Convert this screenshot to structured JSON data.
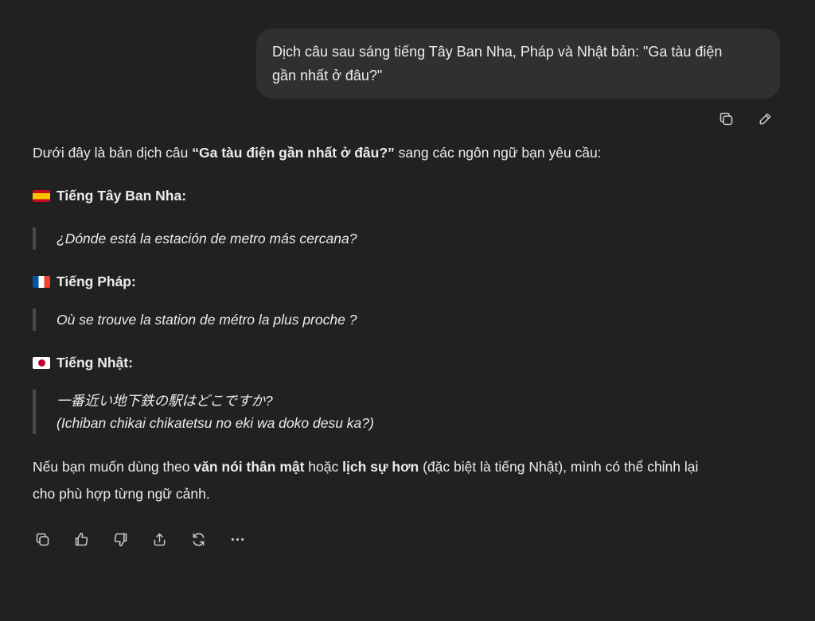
{
  "user_message": {
    "line1": "Dịch câu sau sáng tiếng Tây Ban Nha, Pháp và Nhật bản: \"Ga tàu điện",
    "line2": "gần nhất ở đâu?\""
  },
  "user_actions": {
    "copy_icon": "copy-icon",
    "edit_icon": "pencil-icon"
  },
  "answer": {
    "intro_before": "Dưới đây là bản dịch câu ",
    "intro_bold": "“Ga tàu điện gần nhất ở đâu?”",
    "intro_after": " sang các ngôn ngữ bạn yêu cầu:",
    "sections": [
      {
        "flag": "spain-flag",
        "title": "Tiếng Tây Ban Nha:",
        "lines": [
          "¿Dónde está la estación de metro más cercana?"
        ]
      },
      {
        "flag": "france-flag",
        "title": "Tiếng Pháp:",
        "lines": [
          "Où se trouve la station de métro la plus proche ?"
        ]
      },
      {
        "flag": "japan-flag",
        "title": "Tiếng Nhật:",
        "lines": [
          "一番近い地下鉄の駅はどこですか?",
          "(Ichiban chikai chikatetsu no eki wa doko desu ka?)"
        ]
      }
    ],
    "outro": {
      "part1": "Nếu bạn muốn dùng theo ",
      "bold1": "văn nói thân mật",
      "part2": " hoặc ",
      "bold2": "lịch sự hơn",
      "part3": " (đặc biệt là tiếng Nhật), mình có thể chỉnh lại",
      "line2": "cho phù hợp từng ngữ cảnh."
    }
  },
  "bottom_actions": [
    "copy-icon",
    "thumbs-up-icon",
    "thumbs-down-icon",
    "share-icon",
    "regenerate-icon",
    "more-icon"
  ]
}
